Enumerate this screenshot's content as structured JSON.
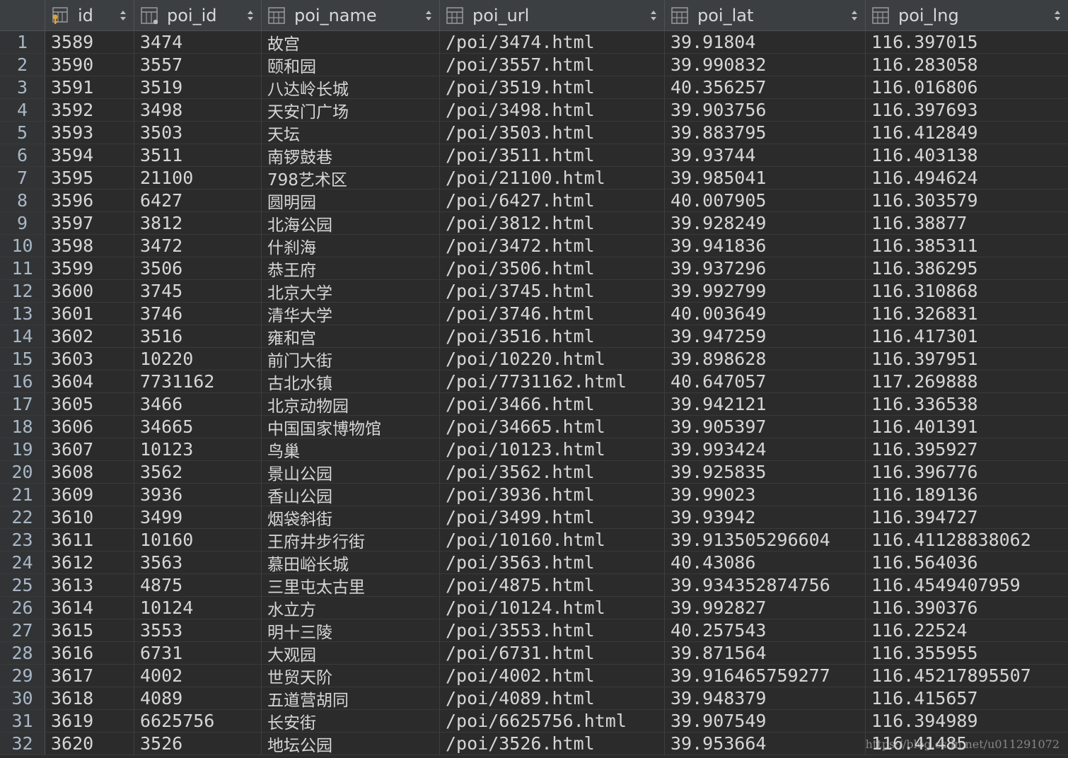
{
  "columns": [
    {
      "label": "id",
      "icon": "primary-key-column-icon"
    },
    {
      "label": "poi_id",
      "icon": "column-icon"
    },
    {
      "label": "poi_name",
      "icon": "column-icon"
    },
    {
      "label": "poi_url",
      "icon": "column-icon"
    },
    {
      "label": "poi_lat",
      "icon": "column-icon"
    },
    {
      "label": "poi_lng",
      "icon": "column-icon"
    }
  ],
  "rows": [
    {
      "n": "1",
      "id": "3589",
      "poi_id": "3474",
      "poi_name": "故宫",
      "poi_url": "/poi/3474.html",
      "poi_lat": "39.91804",
      "poi_lng": "116.397015"
    },
    {
      "n": "2",
      "id": "3590",
      "poi_id": "3557",
      "poi_name": "颐和园",
      "poi_url": "/poi/3557.html",
      "poi_lat": "39.990832",
      "poi_lng": "116.283058"
    },
    {
      "n": "3",
      "id": "3591",
      "poi_id": "3519",
      "poi_name": "八达岭长城",
      "poi_url": "/poi/3519.html",
      "poi_lat": "40.356257",
      "poi_lng": "116.016806"
    },
    {
      "n": "4",
      "id": "3592",
      "poi_id": "3498",
      "poi_name": "天安门广场",
      "poi_url": "/poi/3498.html",
      "poi_lat": "39.903756",
      "poi_lng": "116.397693"
    },
    {
      "n": "5",
      "id": "3593",
      "poi_id": "3503",
      "poi_name": "天坛",
      "poi_url": "/poi/3503.html",
      "poi_lat": "39.883795",
      "poi_lng": "116.412849"
    },
    {
      "n": "6",
      "id": "3594",
      "poi_id": "3511",
      "poi_name": "南锣鼓巷",
      "poi_url": "/poi/3511.html",
      "poi_lat": "39.93744",
      "poi_lng": "116.403138"
    },
    {
      "n": "7",
      "id": "3595",
      "poi_id": "21100",
      "poi_name": "798艺术区",
      "poi_url": "/poi/21100.html",
      "poi_lat": "39.985041",
      "poi_lng": "116.494624"
    },
    {
      "n": "8",
      "id": "3596",
      "poi_id": "6427",
      "poi_name": "圆明园",
      "poi_url": "/poi/6427.html",
      "poi_lat": "40.007905",
      "poi_lng": "116.303579"
    },
    {
      "n": "9",
      "id": "3597",
      "poi_id": "3812",
      "poi_name": "北海公园",
      "poi_url": "/poi/3812.html",
      "poi_lat": "39.928249",
      "poi_lng": "116.38877"
    },
    {
      "n": "10",
      "id": "3598",
      "poi_id": "3472",
      "poi_name": "什刹海",
      "poi_url": "/poi/3472.html",
      "poi_lat": "39.941836",
      "poi_lng": "116.385311"
    },
    {
      "n": "11",
      "id": "3599",
      "poi_id": "3506",
      "poi_name": "恭王府",
      "poi_url": "/poi/3506.html",
      "poi_lat": "39.937296",
      "poi_lng": "116.386295"
    },
    {
      "n": "12",
      "id": "3600",
      "poi_id": "3745",
      "poi_name": "北京大学",
      "poi_url": "/poi/3745.html",
      "poi_lat": "39.992799",
      "poi_lng": "116.310868"
    },
    {
      "n": "13",
      "id": "3601",
      "poi_id": "3746",
      "poi_name": "清华大学",
      "poi_url": "/poi/3746.html",
      "poi_lat": "40.003649",
      "poi_lng": "116.326831"
    },
    {
      "n": "14",
      "id": "3602",
      "poi_id": "3516",
      "poi_name": "雍和宫",
      "poi_url": "/poi/3516.html",
      "poi_lat": "39.947259",
      "poi_lng": "116.417301"
    },
    {
      "n": "15",
      "id": "3603",
      "poi_id": "10220",
      "poi_name": "前门大街",
      "poi_url": "/poi/10220.html",
      "poi_lat": "39.898628",
      "poi_lng": "116.397951"
    },
    {
      "n": "16",
      "id": "3604",
      "poi_id": "7731162",
      "poi_name": "古北水镇",
      "poi_url": "/poi/7731162.html",
      "poi_lat": "40.647057",
      "poi_lng": "117.269888"
    },
    {
      "n": "17",
      "id": "3605",
      "poi_id": "3466",
      "poi_name": "北京动物园",
      "poi_url": "/poi/3466.html",
      "poi_lat": "39.942121",
      "poi_lng": "116.336538"
    },
    {
      "n": "18",
      "id": "3606",
      "poi_id": "34665",
      "poi_name": "中国国家博物馆",
      "poi_url": "/poi/34665.html",
      "poi_lat": "39.905397",
      "poi_lng": "116.401391"
    },
    {
      "n": "19",
      "id": "3607",
      "poi_id": "10123",
      "poi_name": "鸟巢",
      "poi_url": "/poi/10123.html",
      "poi_lat": "39.993424",
      "poi_lng": "116.395927"
    },
    {
      "n": "20",
      "id": "3608",
      "poi_id": "3562",
      "poi_name": "景山公园",
      "poi_url": "/poi/3562.html",
      "poi_lat": "39.925835",
      "poi_lng": "116.396776"
    },
    {
      "n": "21",
      "id": "3609",
      "poi_id": "3936",
      "poi_name": "香山公园",
      "poi_url": "/poi/3936.html",
      "poi_lat": "39.99023",
      "poi_lng": "116.189136"
    },
    {
      "n": "22",
      "id": "3610",
      "poi_id": "3499",
      "poi_name": "烟袋斜街",
      "poi_url": "/poi/3499.html",
      "poi_lat": "39.93942",
      "poi_lng": "116.394727"
    },
    {
      "n": "23",
      "id": "3611",
      "poi_id": "10160",
      "poi_name": "王府井步行街",
      "poi_url": "/poi/10160.html",
      "poi_lat": "39.913505296604",
      "poi_lng": "116.41128838062"
    },
    {
      "n": "24",
      "id": "3612",
      "poi_id": "3563",
      "poi_name": "慕田峪长城",
      "poi_url": "/poi/3563.html",
      "poi_lat": "40.43086",
      "poi_lng": "116.564036"
    },
    {
      "n": "25",
      "id": "3613",
      "poi_id": "4875",
      "poi_name": "三里屯太古里",
      "poi_url": "/poi/4875.html",
      "poi_lat": "39.934352874756",
      "poi_lng": "116.4549407959"
    },
    {
      "n": "26",
      "id": "3614",
      "poi_id": "10124",
      "poi_name": "水立方",
      "poi_url": "/poi/10124.html",
      "poi_lat": "39.992827",
      "poi_lng": "116.390376"
    },
    {
      "n": "27",
      "id": "3615",
      "poi_id": "3553",
      "poi_name": "明十三陵",
      "poi_url": "/poi/3553.html",
      "poi_lat": "40.257543",
      "poi_lng": "116.22524"
    },
    {
      "n": "28",
      "id": "3616",
      "poi_id": "6731",
      "poi_name": "大观园",
      "poi_url": "/poi/6731.html",
      "poi_lat": "39.871564",
      "poi_lng": "116.355955"
    },
    {
      "n": "29",
      "id": "3617",
      "poi_id": "4002",
      "poi_name": "世贸天阶",
      "poi_url": "/poi/4002.html",
      "poi_lat": "39.916465759277",
      "poi_lng": "116.45217895507"
    },
    {
      "n": "30",
      "id": "3618",
      "poi_id": "4089",
      "poi_name": "五道营胡同",
      "poi_url": "/poi/4089.html",
      "poi_lat": "39.948379",
      "poi_lng": "116.415657"
    },
    {
      "n": "31",
      "id": "3619",
      "poi_id": "6625756",
      "poi_name": "长安街",
      "poi_url": "/poi/6625756.html",
      "poi_lat": "39.907549",
      "poi_lng": "116.394989"
    },
    {
      "n": "32",
      "id": "3620",
      "poi_id": "3526",
      "poi_name": "地坛公园",
      "poi_url": "/poi/3526.html",
      "poi_lat": "39.953664",
      "poi_lng": "116.41485"
    }
  ],
  "watermark": "https://blog.csdn.net/u011291072"
}
